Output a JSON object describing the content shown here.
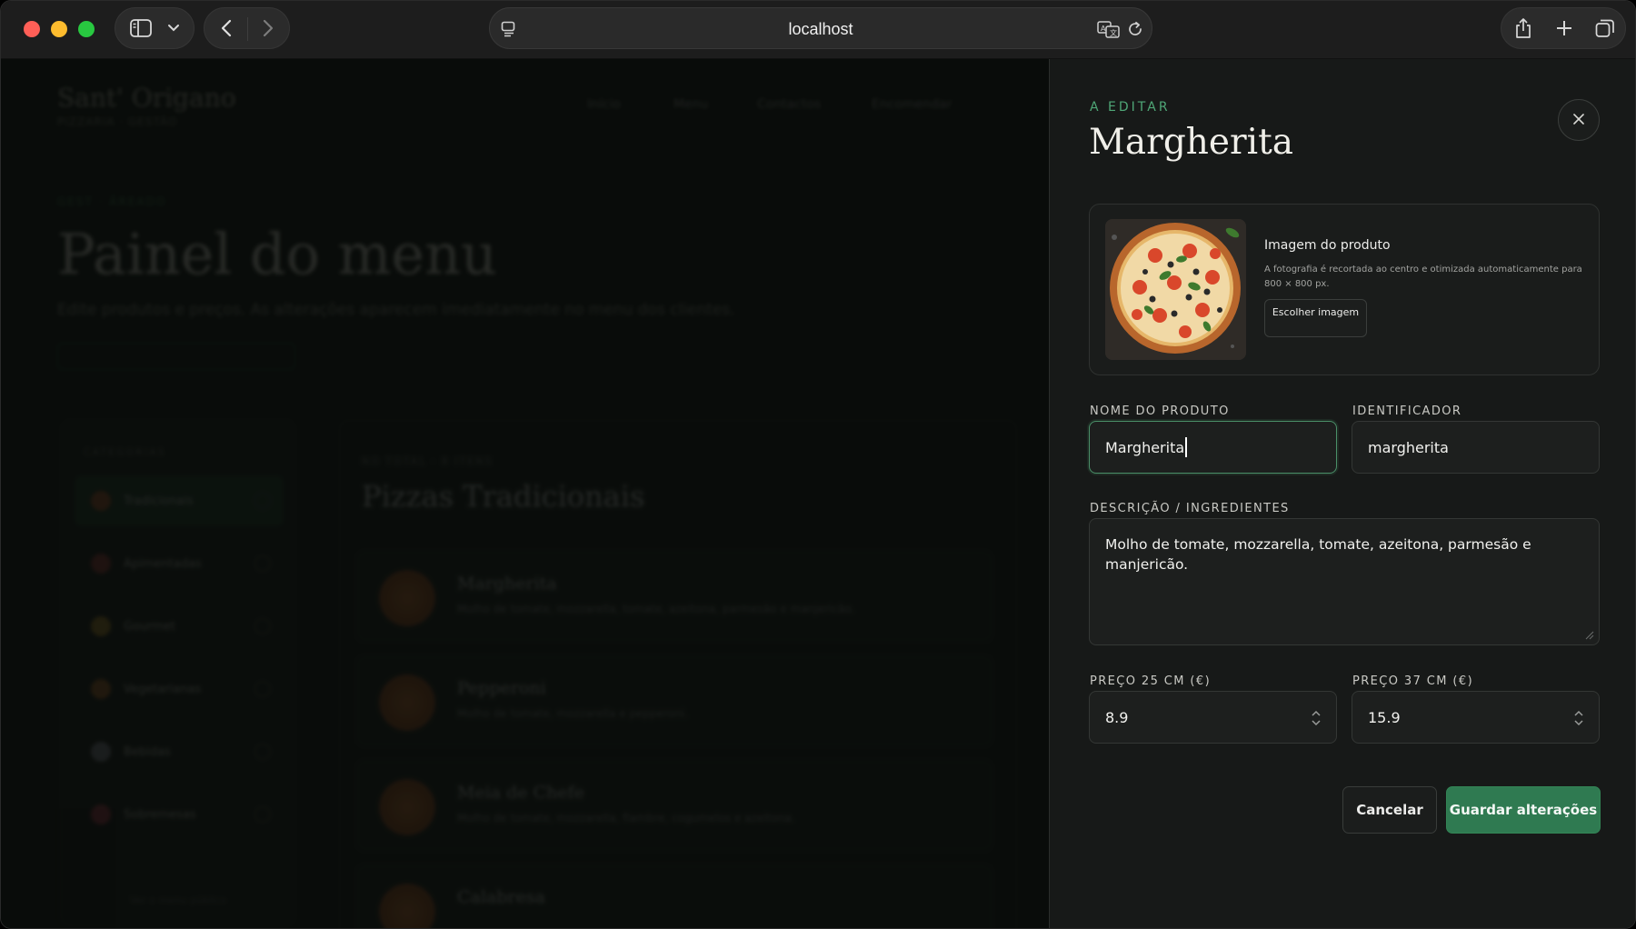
{
  "browser": {
    "address": "localhost"
  },
  "background_page": {
    "brand": "Sant' Origano",
    "brand_sub": "PIZZARIA · GESTÃO",
    "nav": [
      "Início",
      "Menu",
      "Contactos",
      "Encomendar"
    ],
    "eyebrow": "GEST · ÃREADO",
    "title": "Painel do menu",
    "description": "Edite produtos e preços. As alterações aparecem imediatamente no menu dos clientes.",
    "sidebar_heading": "CATEGORIAS",
    "categories": [
      "Tradicionais",
      "Apimentadas",
      "Gourmet",
      "Vegetarianas",
      "Bebidas",
      "Sobremesas"
    ],
    "sidebar_footer": "Ver o menu público",
    "section_eyebrow": "NO TOTAL · 8 ITENS",
    "section_title": "Pizzas Tradicionais",
    "items": [
      {
        "name": "Margherita",
        "desc": "Molho de tomate, mozzarella, tomate, azeitona, parmesão e manjericão."
      },
      {
        "name": "Pepperoni",
        "desc": "Molho de tomate, mozzarella e pepperoni."
      },
      {
        "name": "Meia de Chefe",
        "desc": "Molho de tomate, mozzarella, fiambre, cogumelos e azeitona."
      },
      {
        "name": "Calabresa",
        "desc": ""
      }
    ]
  },
  "panel": {
    "eyebrow": "A EDITAR",
    "title": "Margherita",
    "image": {
      "label": "Imagem do produto",
      "help": "A fotografia é recortada ao centro e otimizada automaticamente para 800 × 800 px.",
      "button": "Escolher imagem"
    },
    "fields": {
      "name_label": "NOME DO PRODUTO",
      "name_value": "Margherita",
      "id_label": "IDENTIFICADOR",
      "id_value": "margherita",
      "desc_label": "DESCRIÇÃO / INGREDIENTES",
      "desc_value": "Molho de tomate, mozzarella, tomate, azeitona, parmesão e manjericão.",
      "price_small_label": "PREÇO 25 CM (€)",
      "price_small_value": "8.9",
      "price_large_label": "PREÇO 37 CM (€)",
      "price_large_value": "15.9"
    },
    "buttons": {
      "cancel": "Cancelar",
      "save": "Guardar alterações"
    }
  },
  "colors": {
    "accent": "#4fa777",
    "save_button": "#2f7a51",
    "panel_bg": "#171918"
  },
  "icons": [
    "sidebar-toggle-icon",
    "chevron-down-icon",
    "back-icon",
    "forward-icon",
    "reader-icon",
    "translate-icon",
    "reload-icon",
    "share-icon",
    "new-tab-icon",
    "tabs-overview-icon",
    "close-icon"
  ]
}
